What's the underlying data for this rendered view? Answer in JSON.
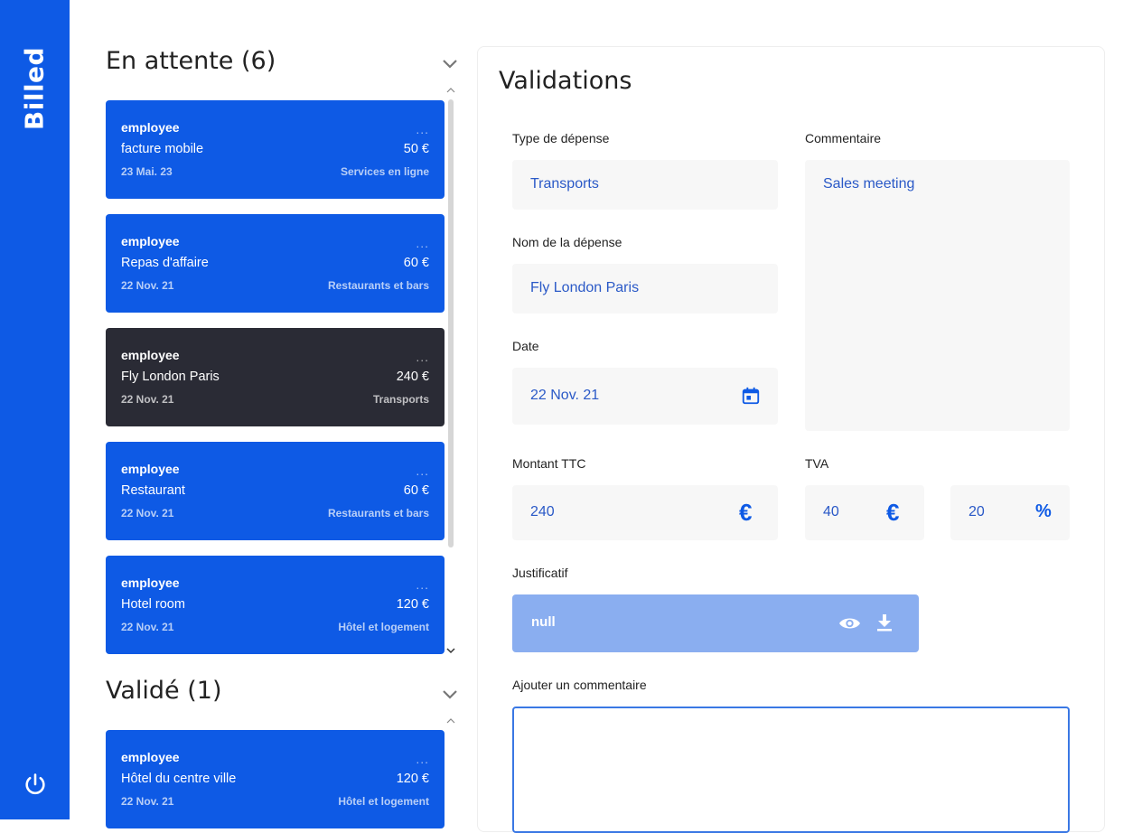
{
  "app": {
    "logo": "Billed"
  },
  "pending": {
    "title": "En attente (6)",
    "bills": [
      {
        "employee": "employee",
        "dots": "...",
        "name": "facture mobile",
        "amount": "50 €",
        "date": "23 Mai. 23",
        "type": "Services en ligne",
        "active": false
      },
      {
        "employee": "employee",
        "dots": "...",
        "name": "Repas d'affaire",
        "amount": "60 €",
        "date": "22 Nov. 21",
        "type": "Restaurants et bars",
        "active": false
      },
      {
        "employee": "employee",
        "dots": "...",
        "name": "Fly London Paris",
        "amount": "240 €",
        "date": "22 Nov. 21",
        "type": "Transports",
        "active": true
      },
      {
        "employee": "employee",
        "dots": "...",
        "name": "Restaurant",
        "amount": "60 €",
        "date": "22 Nov. 21",
        "type": "Restaurants et bars",
        "active": false
      },
      {
        "employee": "employee",
        "dots": "...",
        "name": "Hotel room",
        "amount": "120 €",
        "date": "22 Nov. 21",
        "type": "Hôtel et logement",
        "active": false
      }
    ]
  },
  "validated": {
    "title": "Validé (1)",
    "bills": [
      {
        "employee": "employee",
        "dots": "...",
        "name": "Hôtel du centre ville",
        "amount": "120 €",
        "date": "22 Nov. 21",
        "type": "Hôtel et logement",
        "active": false
      }
    ]
  },
  "form": {
    "title": "Validations",
    "type_label": "Type de dépense",
    "type_value": "Transports",
    "name_label": "Nom de la dépense",
    "name_value": "Fly London Paris",
    "date_label": "Date",
    "date_value": "22 Nov. 21",
    "comment_label": "Commentaire",
    "comment_value": "Sales meeting",
    "amount_label": "Montant TTC",
    "amount_value": "240",
    "amount_icon": "€",
    "tva_label": "TVA",
    "tva_value": "40",
    "tva_icon": "€",
    "pct_value": "20",
    "pct_icon": "%",
    "justif_label": "Justificatif",
    "justif_value": "null",
    "add_comment_label": "Ajouter un commentaire"
  },
  "colors": {
    "brand": "#0E5AE5",
    "active_bill": "#2A2B35",
    "field_text": "#2a59c7"
  }
}
